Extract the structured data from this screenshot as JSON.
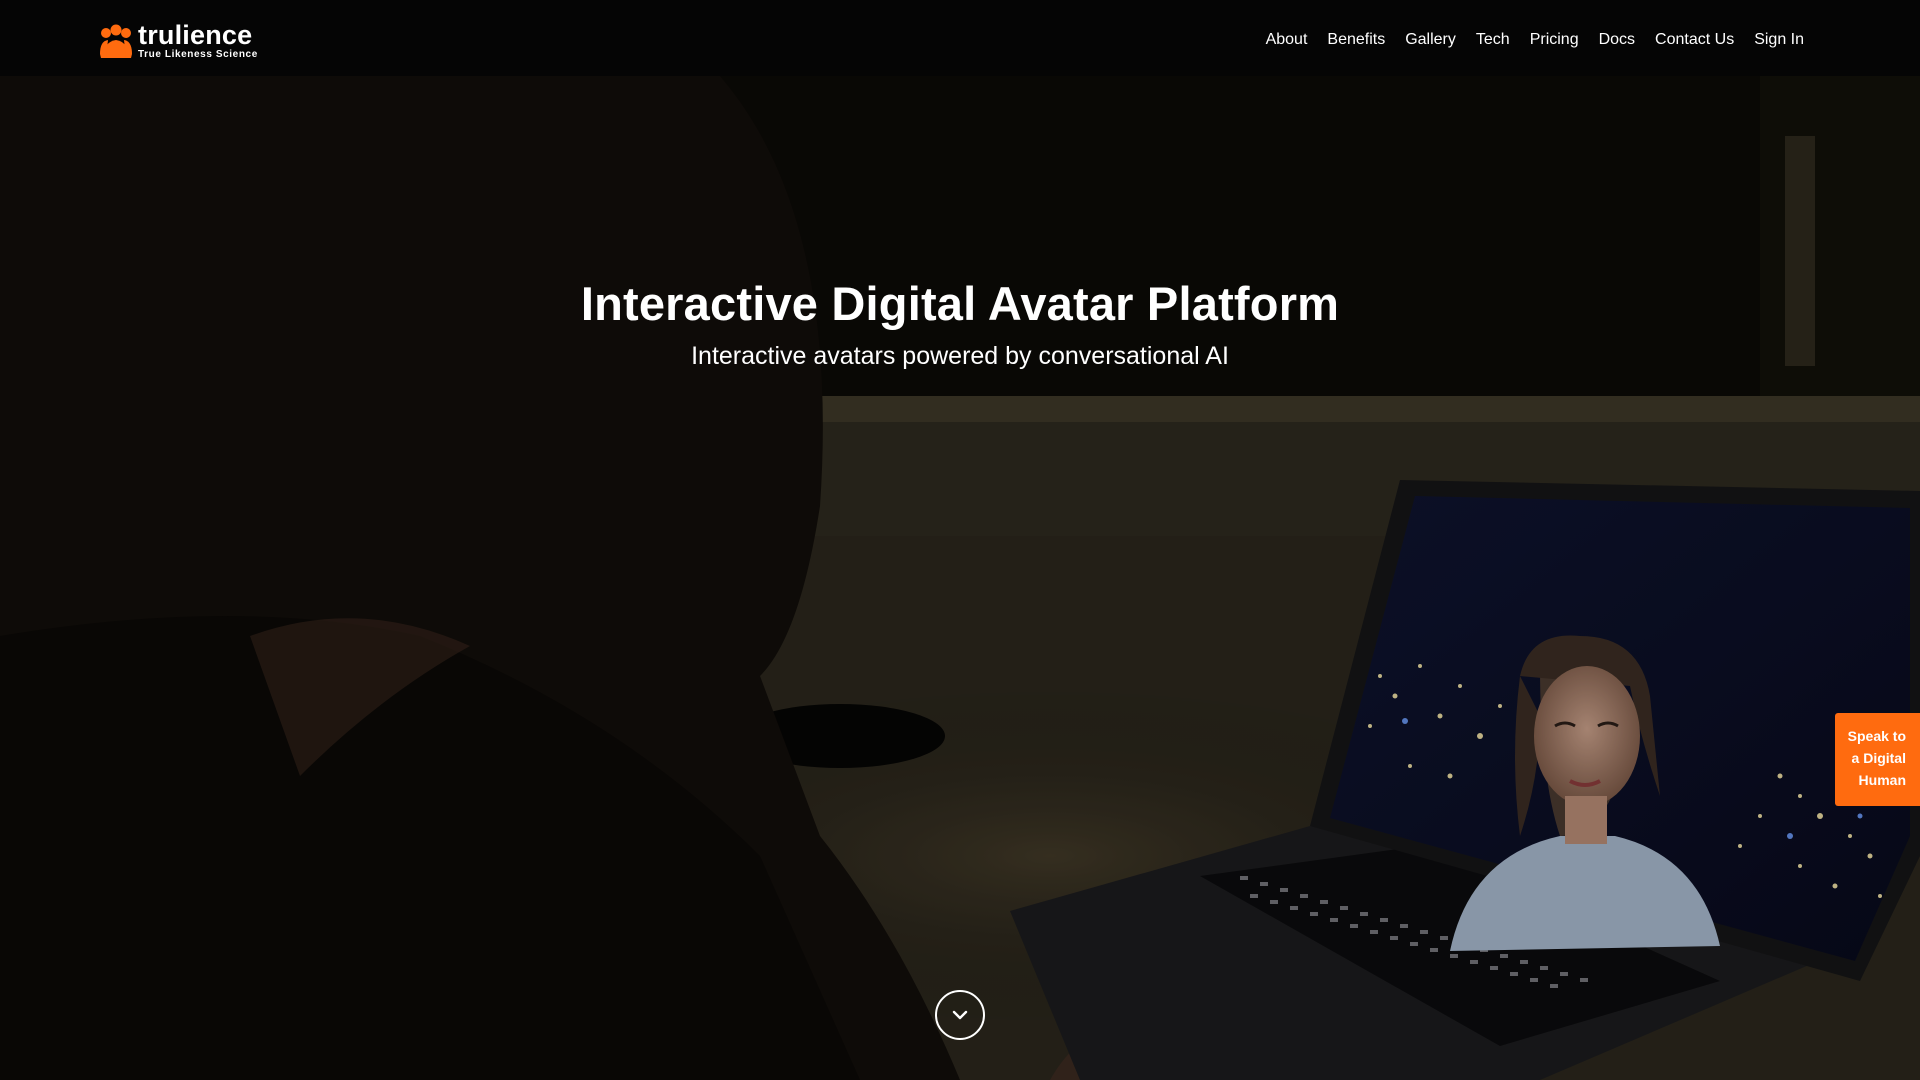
{
  "brand": {
    "name": "trulience",
    "tagline": "True Likeness Science",
    "accent_color": "#ff6b0f"
  },
  "nav": {
    "items": [
      {
        "label": "About"
      },
      {
        "label": "Benefits"
      },
      {
        "label": "Gallery"
      },
      {
        "label": "Tech"
      },
      {
        "label": "Pricing"
      },
      {
        "label": "Docs"
      },
      {
        "label": "Contact Us"
      },
      {
        "label": "Sign In"
      }
    ]
  },
  "hero": {
    "title": "Interactive Digital Avatar Platform",
    "subtitle": "Interactive avatars powered by conversational AI",
    "scroll_icon": "chevron-down-icon"
  },
  "speak_button": {
    "lines": [
      "Speak to",
      "a Digital",
      "Human"
    ]
  }
}
